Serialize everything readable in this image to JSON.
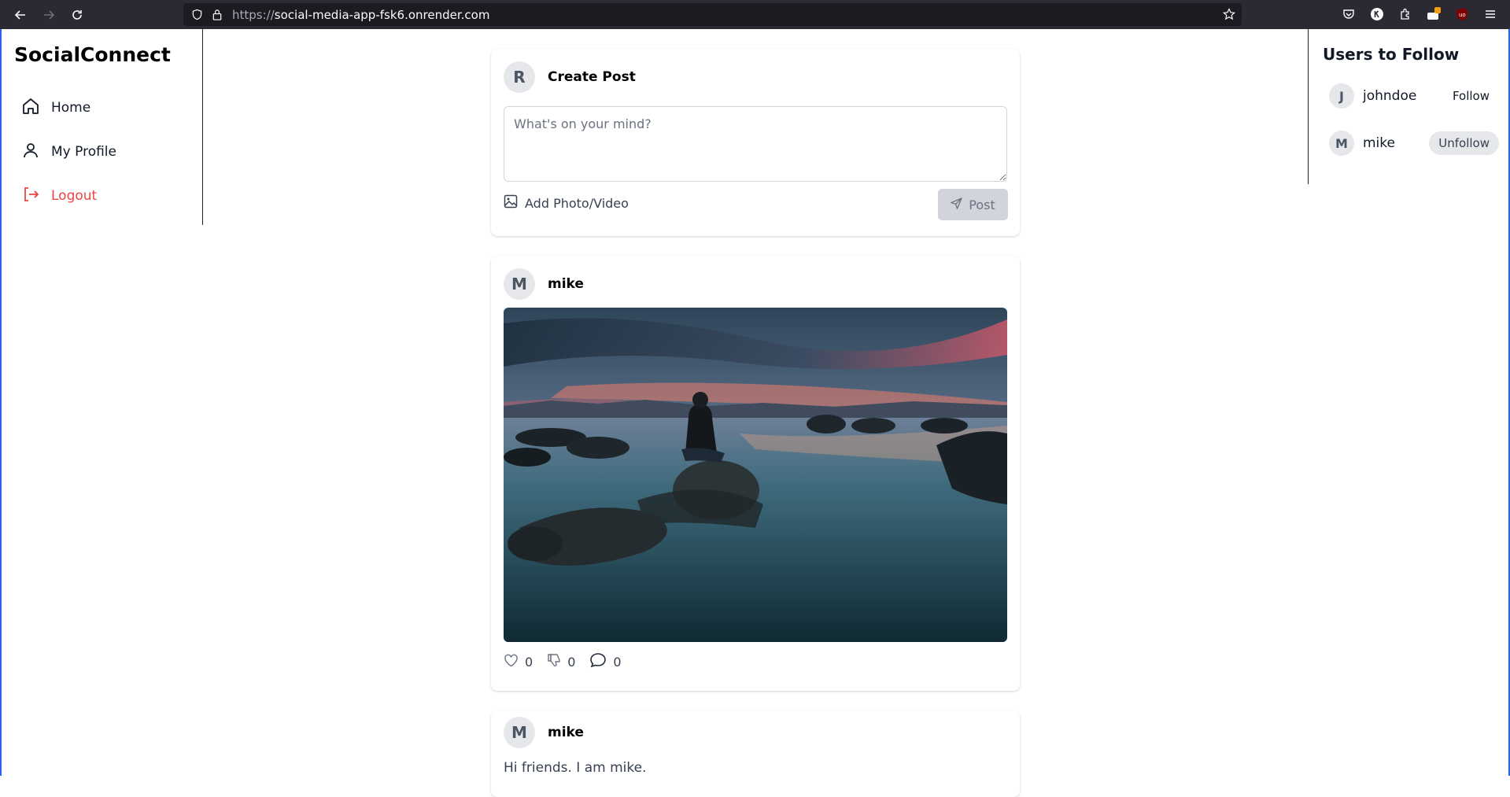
{
  "browser": {
    "url_scheme": "https://",
    "url_host": "social-media-app-fsk6.onrender.com",
    "toolbar_icons": [
      "back-icon",
      "forward-icon",
      "reload-icon",
      "shield-icon",
      "lock-icon",
      "bookmark-star-icon",
      "pocket-icon",
      "account-icon",
      "extensions-icon",
      "extension-badge-icon",
      "ublock-icon",
      "menu-icon"
    ]
  },
  "sidebar": {
    "brand": "SocialConnect",
    "items": [
      {
        "label": "Home",
        "icon": "home-icon"
      },
      {
        "label": "My Profile",
        "icon": "user-icon"
      },
      {
        "label": "Logout",
        "icon": "logout-icon",
        "color": "#ef4444"
      }
    ]
  },
  "right_panel": {
    "title": "Users to Follow",
    "users": [
      {
        "initial": "J",
        "name": "johndoe",
        "action": "Follow"
      },
      {
        "initial": "M",
        "name": "mike",
        "action": "Unfollow"
      }
    ]
  },
  "create_post": {
    "avatar_initial": "R",
    "title": "Create Post",
    "placeholder": "What's on your mind?",
    "add_media_label": "Add Photo/Video",
    "post_label": "Post"
  },
  "posts": [
    {
      "avatar_initial": "M",
      "author": "mike",
      "image_desc": "person-on-rock-at-sunset-photo",
      "likes": "0",
      "dislikes": "0",
      "comments": "0"
    },
    {
      "avatar_initial": "M",
      "author": "mike",
      "text": "Hi friends. I am mike."
    }
  ],
  "colors": {
    "accent_red": "#ef4444",
    "chrome_bg": "#2b2a33",
    "avatar_bg": "#e5e7eb",
    "disabled_btn": "#d1d5db"
  }
}
